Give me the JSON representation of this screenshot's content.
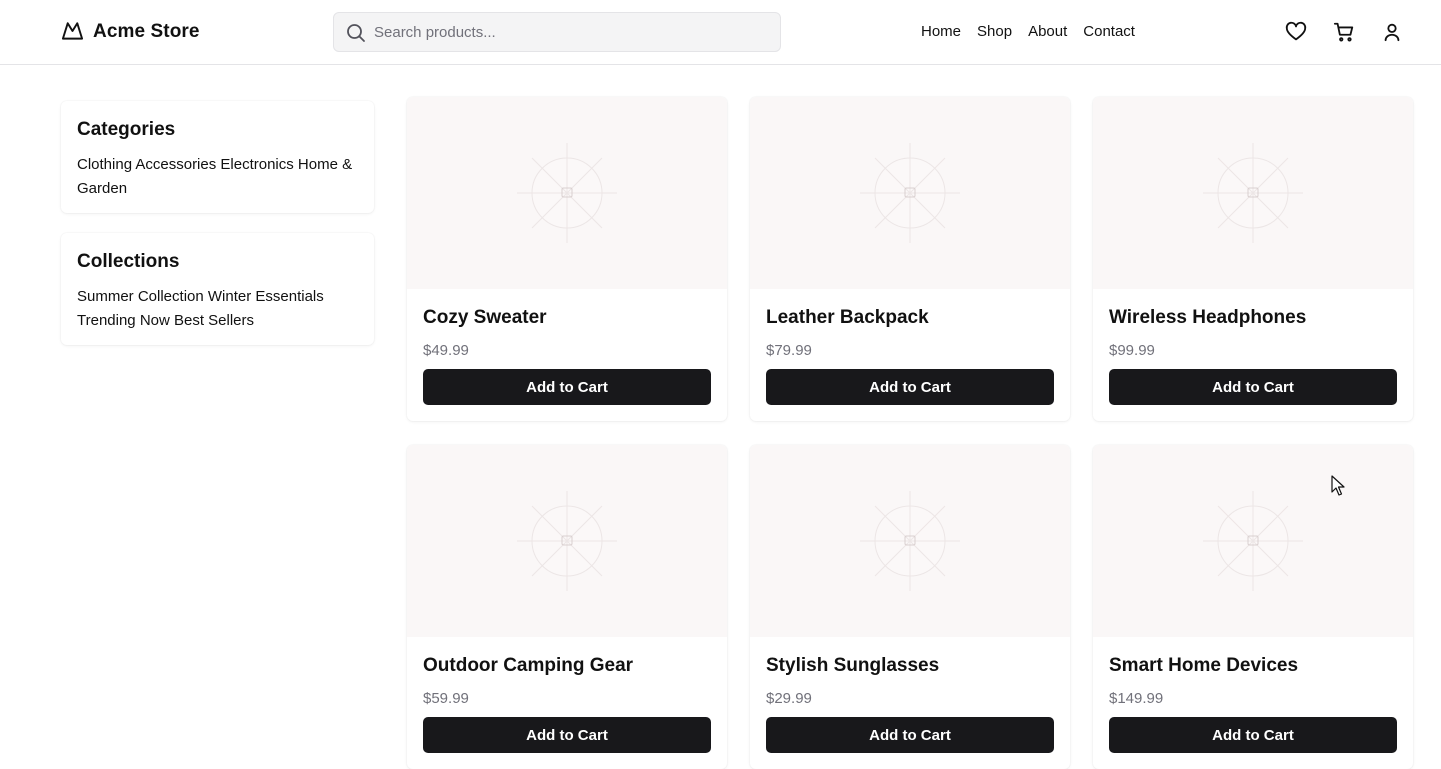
{
  "header": {
    "brand": "Acme Store",
    "logo_icon": "mountain-logo-icon",
    "search": {
      "placeholder": "Search products...",
      "value": "",
      "icon": "search-icon"
    },
    "nav": [
      "Home",
      "Shop",
      "About",
      "Contact"
    ],
    "icons": [
      "heart-icon",
      "cart-icon",
      "user-icon"
    ]
  },
  "sidebar": {
    "categories": {
      "title": "Categories",
      "items_text": "Clothing Accessories Electronics Home & Garden"
    },
    "collections": {
      "title": "Collections",
      "items_text": "Summer Collection Winter Essentials Trending Now Best Sellers"
    }
  },
  "products": [
    {
      "name": "Cozy Sweater",
      "price": "$49.99",
      "button": "Add to Cart"
    },
    {
      "name": "Leather Backpack",
      "price": "$79.99",
      "button": "Add to Cart"
    },
    {
      "name": "Wireless Headphones",
      "price": "$99.99",
      "button": "Add to Cart"
    },
    {
      "name": "Outdoor Camping Gear",
      "price": "$59.99",
      "button": "Add to Cart"
    },
    {
      "name": "Stylish Sunglasses",
      "price": "$29.99",
      "button": "Add to Cart"
    },
    {
      "name": "Smart Home Devices",
      "price": "$149.99",
      "button": "Add to Cart"
    }
  ],
  "colors": {
    "button_bg": "#18181b",
    "price_text": "#71717a",
    "image_placeholder_bg": "#faf7f7",
    "search_bg": "#f4f4f5"
  }
}
